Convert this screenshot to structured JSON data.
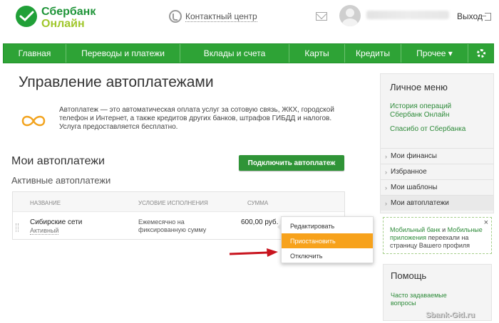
{
  "header": {
    "logo_line1": "Сбербанк",
    "logo_line2": "Онлайн",
    "contact_center": "Контактный центр",
    "logout": "Выход"
  },
  "nav": {
    "items": [
      "Главная",
      "Переводы и платежи",
      "Вклады и счета",
      "Карты",
      "Кредиты",
      "Прочее ▾"
    ]
  },
  "main": {
    "title": "Управление автоплатежами",
    "description": "Автоплатеж — это автоматическая оплата услуг за сотовую связь, ЖКХ, городской телефон и Интернет, а также кредитов других банков, штрафов ГИБДД и налогов. Услуга предоставляется бесплатно.",
    "my_autopayments": "Мои автоплатежи",
    "connect_button": "Подключить автоплатеж",
    "active_title": "Активные автоплатежи",
    "table": {
      "headers": [
        "Название",
        "Условие исполнения",
        "Сумма"
      ],
      "row": {
        "name": "Сибирские сети",
        "status": "Активный",
        "condition": "Ежемесячно на фиксированную сумму",
        "sum": "600,00 руб."
      }
    },
    "dropdown": [
      "Редактировать",
      "Приостановить",
      "Отключить"
    ]
  },
  "sidebar": {
    "title": "Личное меню",
    "links": [
      "История операций Сбербанк Онлайн",
      "Спасибо от Сбербанка"
    ],
    "items": [
      "Мои финансы",
      "Избранное",
      "Мои шаблоны",
      "Мои автоплатежи"
    ],
    "notice_part1": "Мобильный банк",
    "notice_and": " и ",
    "notice_part2": "Мобильные приложения",
    "notice_rest": " переехали на страницу Вашего профиля",
    "notice_close": "×",
    "help_title": "Помощь",
    "help_link": "Часто задаваемые вопросы"
  },
  "watermark": "Sbank-Gid.ru",
  "colors": {
    "brand_green": "#2ea336",
    "button_green": "#2f9437",
    "highlight_orange": "#f7a21c",
    "arrow_red": "#c8141e"
  }
}
